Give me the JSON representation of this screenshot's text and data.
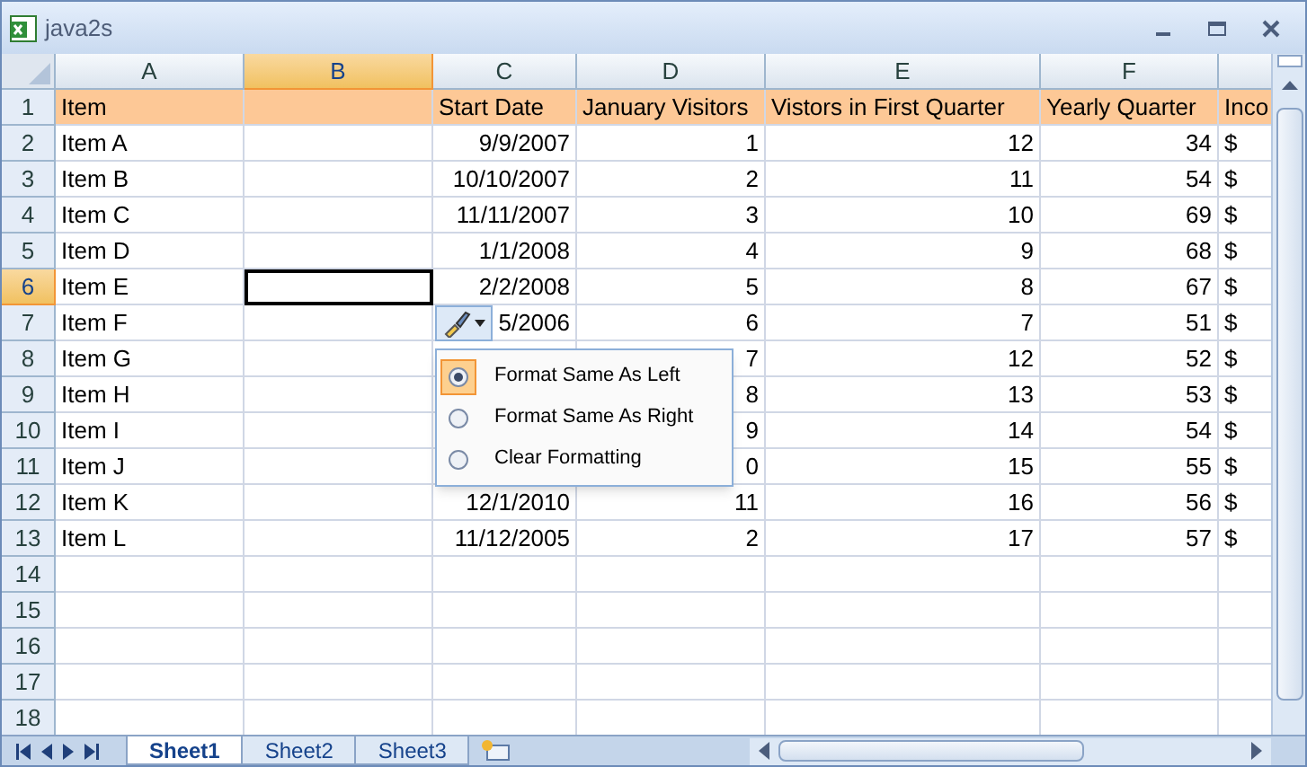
{
  "window": {
    "title": "java2s"
  },
  "columns": [
    {
      "label": "A",
      "selected": false
    },
    {
      "label": "B",
      "selected": true
    },
    {
      "label": "C",
      "selected": false
    },
    {
      "label": "D",
      "selected": false
    },
    {
      "label": "E",
      "selected": false
    },
    {
      "label": "F",
      "selected": false
    },
    {
      "selected": false
    }
  ],
  "rows": [
    {
      "number": "1",
      "selected": false,
      "header": true,
      "cells": [
        {
          "text": "Item"
        },
        {},
        {
          "text": "Start Date"
        },
        {
          "text": "January Visitors"
        },
        {
          "text": "Vistors in First Quarter"
        },
        {
          "text": "Yearly Quarter"
        },
        {
          "text": "Inco"
        }
      ]
    },
    {
      "number": "2",
      "selected": false,
      "cells": [
        {
          "text": "Item A"
        },
        {},
        {
          "text": "9/9/2007",
          "kind": "number"
        },
        {
          "text": "1",
          "kind": "number"
        },
        {
          "text": "12",
          "kind": "number"
        },
        {
          "text": "34",
          "kind": "number"
        },
        {
          "text": "$"
        }
      ]
    },
    {
      "number": "3",
      "selected": false,
      "cells": [
        {
          "text": "Item B"
        },
        {},
        {
          "text": "10/10/2007",
          "kind": "number"
        },
        {
          "text": "2",
          "kind": "number"
        },
        {
          "text": "11",
          "kind": "number"
        },
        {
          "text": "54",
          "kind": "number"
        },
        {
          "text": "$"
        }
      ]
    },
    {
      "number": "4",
      "selected": false,
      "cells": [
        {
          "text": "Item C"
        },
        {},
        {
          "text": "11/11/2007",
          "kind": "number"
        },
        {
          "text": "3",
          "kind": "number"
        },
        {
          "text": "10",
          "kind": "number"
        },
        {
          "text": "69",
          "kind": "number"
        },
        {
          "text": "$"
        }
      ]
    },
    {
      "number": "5",
      "selected": false,
      "cells": [
        {
          "text": "Item D"
        },
        {},
        {
          "text": "1/1/2008",
          "kind": "number"
        },
        {
          "text": "4",
          "kind": "number"
        },
        {
          "text": "9",
          "kind": "number"
        },
        {
          "text": "68",
          "kind": "number"
        },
        {
          "text": "$"
        }
      ]
    },
    {
      "number": "6",
      "selected": true,
      "cells": [
        {
          "text": "Item E"
        },
        {},
        {
          "text": "2/2/2008",
          "kind": "number"
        },
        {
          "text": "5",
          "kind": "number"
        },
        {
          "text": "8",
          "kind": "number"
        },
        {
          "text": "67",
          "kind": "number"
        },
        {
          "text": "$"
        }
      ]
    },
    {
      "number": "7",
      "selected": false,
      "cells": [
        {
          "text": "Item F"
        },
        {},
        {
          "text": "5/2006",
          "kind": "number"
        },
        {
          "text": "6",
          "kind": "number"
        },
        {
          "text": "7",
          "kind": "number"
        },
        {
          "text": "51",
          "kind": "number"
        },
        {
          "text": "$"
        }
      ]
    },
    {
      "number": "8",
      "selected": false,
      "cells": [
        {
          "text": "Item G"
        },
        {},
        {},
        {
          "text": "7",
          "kind": "number"
        },
        {
          "text": "12",
          "kind": "number"
        },
        {
          "text": "52",
          "kind": "number"
        },
        {
          "text": "$"
        }
      ]
    },
    {
      "number": "9",
      "selected": false,
      "cells": [
        {
          "text": "Item H"
        },
        {},
        {},
        {
          "text": "8",
          "kind": "number"
        },
        {
          "text": "13",
          "kind": "number"
        },
        {
          "text": "53",
          "kind": "number"
        },
        {
          "text": "$"
        }
      ]
    },
    {
      "number": "10",
      "selected": false,
      "cells": [
        {
          "text": "Item I"
        },
        {},
        {},
        {
          "text": "9",
          "kind": "number"
        },
        {
          "text": "14",
          "kind": "number"
        },
        {
          "text": "54",
          "kind": "number"
        },
        {
          "text": "$"
        }
      ]
    },
    {
      "number": "11",
      "selected": false,
      "cells": [
        {
          "text": "Item J"
        },
        {},
        {},
        {
          "text": "0",
          "kind": "number"
        },
        {
          "text": "15",
          "kind": "number"
        },
        {
          "text": "55",
          "kind": "number"
        },
        {
          "text": "$"
        }
      ]
    },
    {
      "number": "12",
      "selected": false,
      "cells": [
        {
          "text": "Item K"
        },
        {},
        {
          "text": "12/1/2010",
          "kind": "number"
        },
        {
          "text": "11",
          "kind": "number"
        },
        {
          "text": "16",
          "kind": "number"
        },
        {
          "text": "56",
          "kind": "number"
        },
        {
          "text": "$"
        }
      ]
    },
    {
      "number": "13",
      "selected": false,
      "cells": [
        {
          "text": "Item L"
        },
        {},
        {
          "text": "11/12/2005",
          "kind": "number"
        },
        {
          "text": "2",
          "kind": "number"
        },
        {
          "text": "17",
          "kind": "number"
        },
        {
          "text": "57",
          "kind": "number"
        },
        {
          "text": "$"
        }
      ]
    },
    {
      "number": "14",
      "selected": false,
      "cells": []
    },
    {
      "number": "15",
      "selected": false,
      "cells": []
    },
    {
      "number": "16",
      "selected": false,
      "cells": []
    },
    {
      "number": "17",
      "selected": false,
      "cells": []
    },
    {
      "number": "18",
      "selected": false,
      "cells": []
    }
  ],
  "paste_options": {
    "menu": [
      {
        "label": "Format Same As Left",
        "selected": true
      },
      {
        "label": "Format Same As Right",
        "selected": false
      },
      {
        "label": "Clear Formatting",
        "selected": false
      }
    ]
  },
  "sheet_tabs": [
    {
      "label": "Sheet1",
      "selected": true
    },
    {
      "label": "Sheet2",
      "selected": false
    },
    {
      "label": "Sheet3",
      "selected": false
    }
  ]
}
